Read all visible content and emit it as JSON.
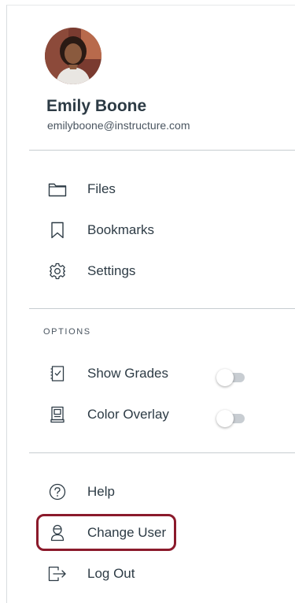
{
  "user": {
    "name": "Emily Boone",
    "email": "emilyboone@instructure.com",
    "avatar_icon": "user-avatar-photo"
  },
  "menu": {
    "items": [
      {
        "label": "Files",
        "icon": "folder-icon"
      },
      {
        "label": "Bookmarks",
        "icon": "bookmark-icon"
      },
      {
        "label": "Settings",
        "icon": "gear-icon"
      }
    ]
  },
  "options": {
    "heading": "OPTIONS",
    "items": [
      {
        "label": "Show Grades",
        "icon": "grades-icon",
        "enabled": false
      },
      {
        "label": "Color Overlay",
        "icon": "color-overlay-icon",
        "enabled": false
      }
    ]
  },
  "footer": {
    "items": [
      {
        "label": "Help",
        "icon": "help-icon"
      },
      {
        "label": "Change User",
        "icon": "change-user-icon",
        "highlighted": true
      },
      {
        "label": "Log Out",
        "icon": "logout-icon"
      }
    ]
  },
  "colors": {
    "highlight": "#8b1a2b",
    "text": "#2d3b45",
    "toggle_off": "#c8cdd2"
  }
}
